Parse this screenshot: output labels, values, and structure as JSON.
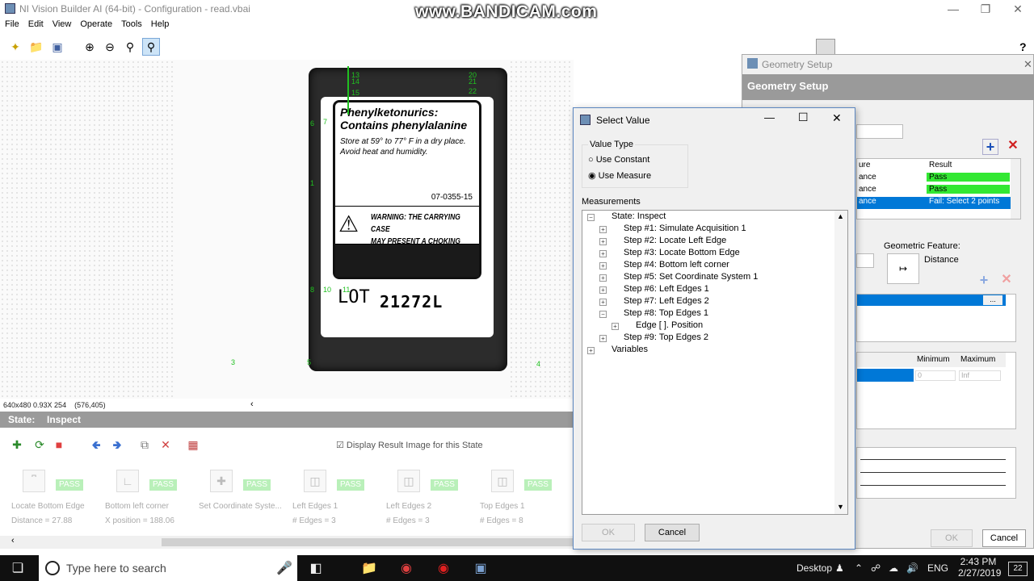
{
  "window": {
    "title": "NI Vision Builder AI (64-bit) - Configuration - read.vbai",
    "watermark": "www.BANDICAM.com"
  },
  "menu": [
    "File",
    "Edit",
    "View",
    "Operate",
    "Tools",
    "Help"
  ],
  "image": {
    "label_title_1": "Phenylketonurics:",
    "label_title_2": "Contains phenylalanine",
    "storage_1": "Store at 59° to 77° F in a dry place.",
    "storage_2": "Avoid heat and humidity.",
    "code": "07-0355-15",
    "warning_1": "WARNING: THE CARRYING CASE",
    "warning_2": "MAY PRESENT A CHOKING HAZARD",
    "lot_label": "LOT",
    "lot_number": "21272L",
    "markers": {
      "m13": "13",
      "m20": "20",
      "m14": "14",
      "m21": "21",
      "m15": "15",
      "m22": "22",
      "m6": "6",
      "m7": "7",
      "m1": "1",
      "m8": "8",
      "m10": "10",
      "m11": "11",
      "m3": "3",
      "m5": "5",
      "m4": "4"
    },
    "status": "640x480 0.93X 254",
    "coords": "(576,405)"
  },
  "state": {
    "label": "State:",
    "value": "Inspect",
    "display_result": "Display Result Image for this State"
  },
  "steps": [
    {
      "name": "Locate Bottom Edge",
      "value": "Distance = 27.88",
      "status": "PASS"
    },
    {
      "name": "Bottom left corner",
      "value": "X position = 188.06",
      "status": "PASS"
    },
    {
      "name": "Set Coordinate Syste...",
      "value": "",
      "status": "PASS"
    },
    {
      "name": "Left Edges 1",
      "value": "# Edges = 3",
      "status": "PASS"
    },
    {
      "name": "Left Edges 2",
      "value": "# Edges = 3",
      "status": "PASS"
    },
    {
      "name": "Top Edges 1",
      "value": "# Edges = 8",
      "status": "PASS"
    }
  ],
  "geometry": {
    "window_title": "Geometry Setup",
    "header": "Geometry Setup",
    "table_headers": [
      "ure",
      "Result"
    ],
    "rows": [
      {
        "c1": "ance",
        "result": "Pass",
        "state": "pass"
      },
      {
        "c1": "ance",
        "result": "Pass",
        "state": "pass"
      },
      {
        "c1": "ance",
        "result": "Fail: Select 2 points",
        "state": "selected"
      }
    ],
    "geometric_feature_label": "Geometric Feature:",
    "geometric_feature_value": "Distance",
    "ellipsis": "...",
    "min_label": "Minimum",
    "max_label": "Maximum",
    "min_value": "0",
    "max_value": "Inf",
    "ok": "OK",
    "cancel": "Cancel"
  },
  "dialog": {
    "title": "Select Value",
    "value_type_label": "Value Type",
    "use_constant": "Use Constant",
    "use_measure": "Use Measure",
    "measurements_label": "Measurements",
    "tree": [
      {
        "text": "State: Inspect"
      },
      {
        "text": "Step #1: Simulate Acquisition 1"
      },
      {
        "text": "Step #2: Locate Left Edge"
      },
      {
        "text": "Step #3: Locate Bottom Edge"
      },
      {
        "text": "Step #4: Bottom left corner"
      },
      {
        "text": "Step #5: Set Coordinate System 1"
      },
      {
        "text": "Step #6: Left Edges 1"
      },
      {
        "text": "Step #7: Left Edges 2"
      },
      {
        "text": "Step #8: Top Edges 1"
      },
      {
        "text": "Edge [ ]. Position"
      },
      {
        "text": "Step #9: Top Edges 2"
      },
      {
        "text": "Variables"
      }
    ],
    "ok": "OK",
    "cancel": "Cancel"
  },
  "taskbar": {
    "search_placeholder": "Type here to search",
    "desktop": "Desktop",
    "language": "ENG",
    "time": "2:43 PM",
    "date": "2/27/2019",
    "notification_count": "22"
  }
}
